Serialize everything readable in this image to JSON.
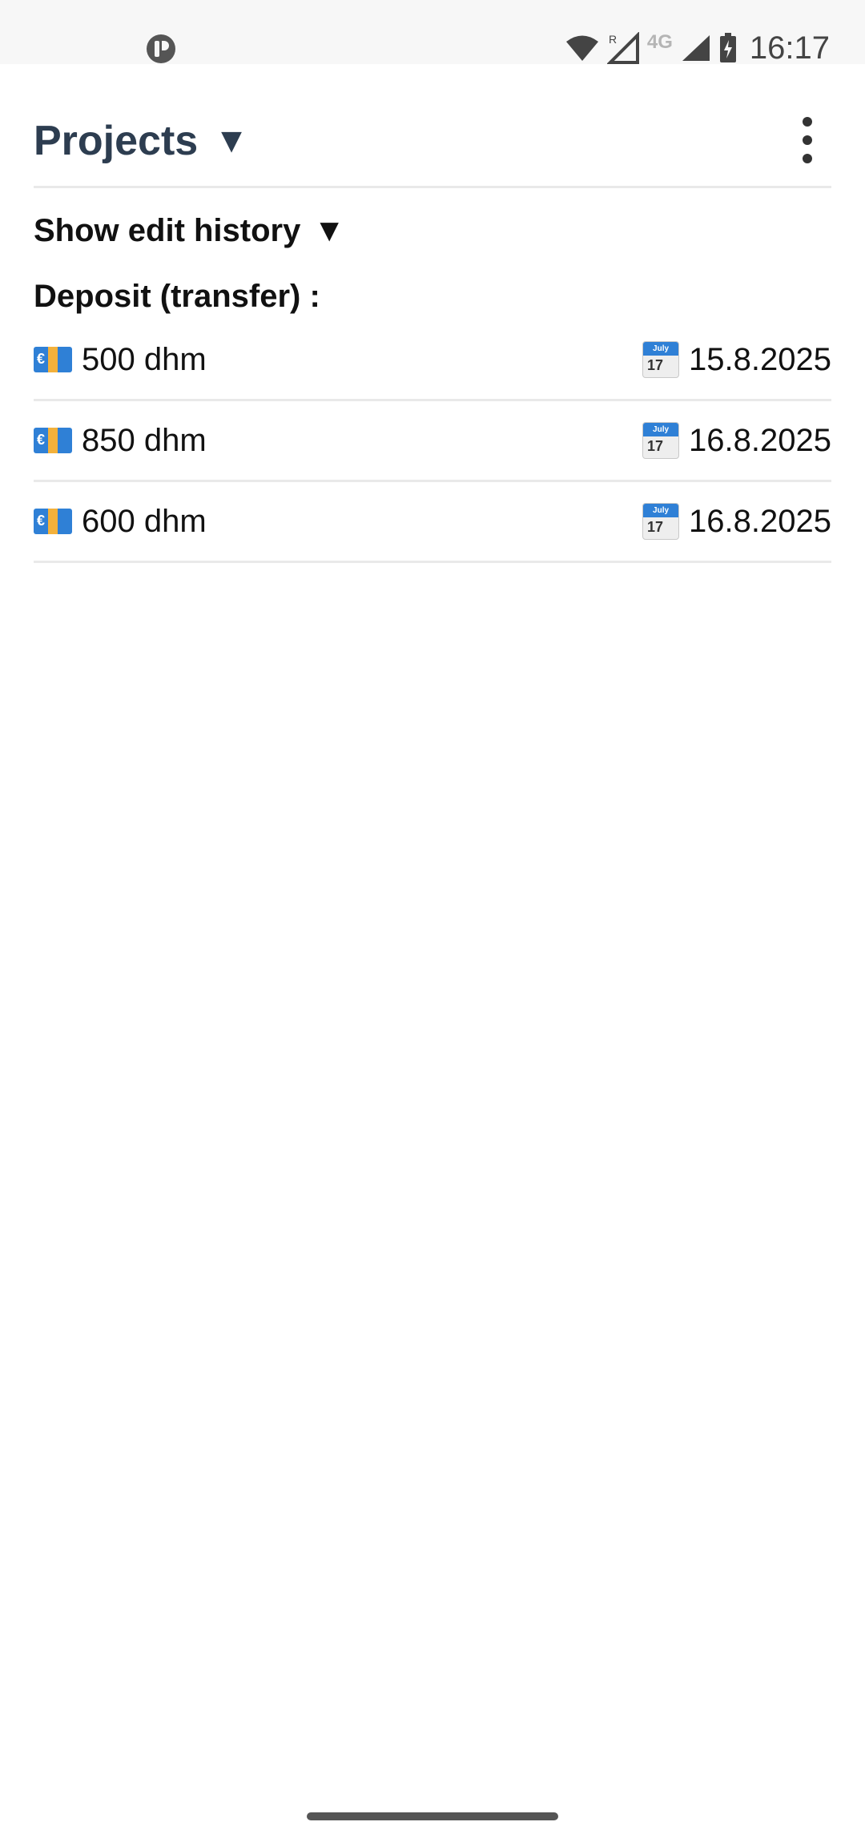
{
  "status_bar": {
    "time": "16:17",
    "network": "4G",
    "roaming": "R"
  },
  "header": {
    "title": "Projects",
    "title_caret": "▼"
  },
  "history_toggle": {
    "label": "Show edit history",
    "caret": "▼"
  },
  "section": {
    "label": "Deposit (transfer) :"
  },
  "icons": {
    "money": "money-with-euro-icon",
    "calendar": "calendar-icon",
    "calendar_month": "July",
    "calendar_day": "17"
  },
  "entries": [
    {
      "amount": "500 dhm",
      "date": "15.8.2025"
    },
    {
      "amount": "850 dhm",
      "date": "16.8.2025"
    },
    {
      "amount": "600 dhm",
      "date": "16.8.2025"
    }
  ]
}
